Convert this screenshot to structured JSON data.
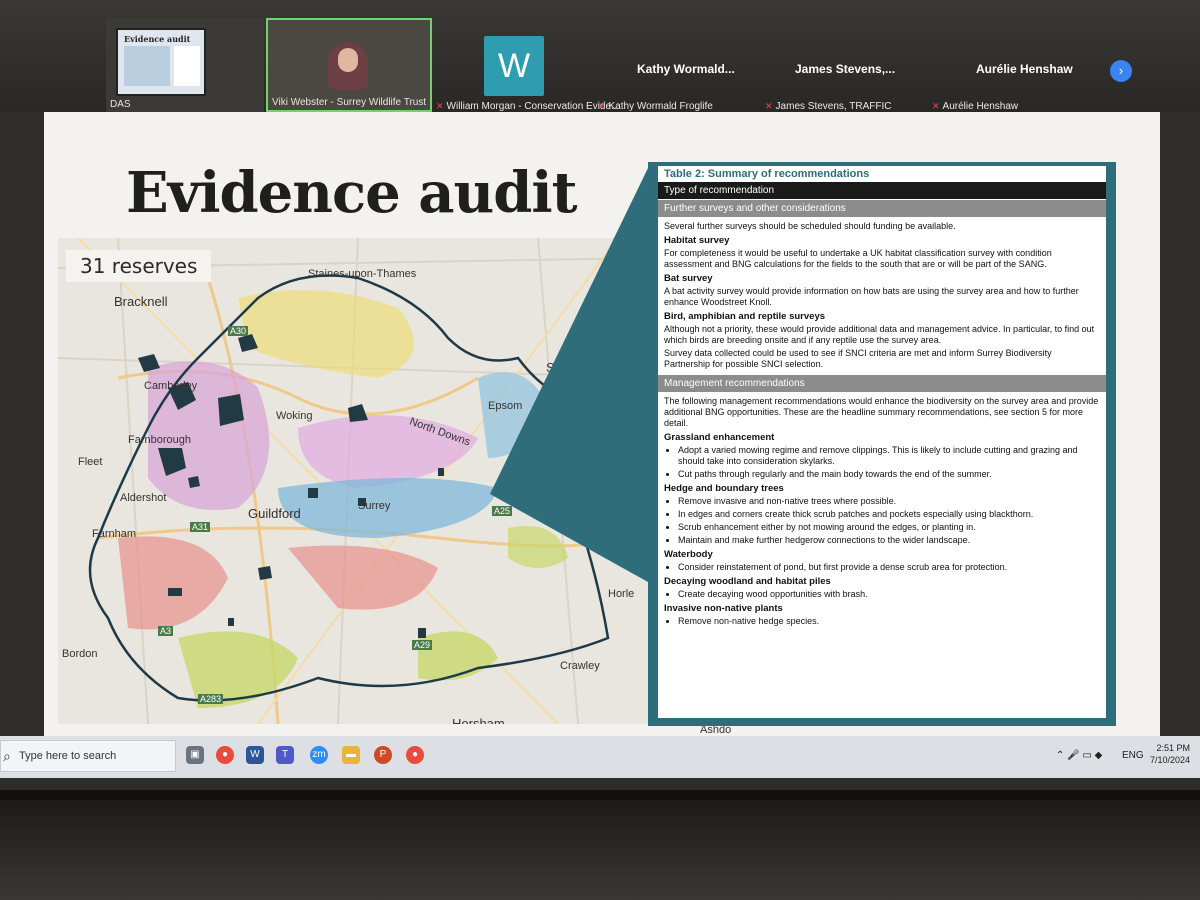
{
  "participants": {
    "tile1_caption": "DAS",
    "tile1_thumb_title": "Evidence audit",
    "tile2_caption": "Viki Webster - Surrey Wildlife Trust",
    "avatar_letter": "W",
    "cap_william": "William Morgan - Conservation Evide...",
    "name_kathy": "Kathy Wormald...",
    "cap_kathy": "Kathy Wormald Froglife",
    "name_james": "James Stevens,...",
    "cap_james": "James Stevens, TRAFFIC",
    "name_aurelie": "Aurélie Henshaw",
    "cap_aurelie": "Aurélie Henshaw",
    "next_glyph": "›"
  },
  "slide": {
    "title": "Evidence audit",
    "badge": "31 reserves",
    "places": {
      "staines": "Staines-upon-Thames",
      "bracknell": "Bracknell",
      "sutton": "Sutton",
      "camberley": "Camberley",
      "woking": "Woking",
      "epsom": "Epsom",
      "farnborough": "Farnborough",
      "north_downs": "North Downs",
      "fleet": "Fleet",
      "aldershot": "Aldershot",
      "guildford": "Guildford",
      "surrey": "Surrey",
      "farnham": "Farnham",
      "bordon": "Bordon",
      "horley": "Horle",
      "crawley": "Crawley",
      "horsham": "Horsham",
      "ashdown": "Ashdo"
    },
    "roads": {
      "a30": "A30",
      "a31": "A31",
      "a3": "A3",
      "a25": "A25",
      "a29": "A29",
      "a283": "A283"
    }
  },
  "table": {
    "caption": "Table 2: Summary of recommendations",
    "header": "Type of recommendation",
    "section1": "Further surveys and other considerations",
    "s1_intro": "Several further surveys should be scheduled should funding be available.",
    "h_habitat": "Habitat survey",
    "p_habitat": "For completeness it would be useful to undertake a UK habitat classification survey with condition assessment and BNG calculations for the fields to the south that are or will be part of the SANG.",
    "h_bat": "Bat survey",
    "p_bat": "A bat activity survey would provide information on how bats are using the survey area and how to further enhance Woodstreet Knoll.",
    "h_bird": "Bird, amphibian and reptile surveys",
    "p_bird": "Although not a priority, these would provide additional data and management advice.  In particular, to find out which birds are breeding onsite and if any reptile use the survey area.",
    "p_snci": "Survey data collected could be used to see if SNCI criteria are met and inform Surrey Biodiversity Partnership for possible SNCI selection.",
    "section2": "Management recommendations",
    "s2_intro": "The following management recommendations would enhance the biodiversity on the survey area and provide additional BNG opportunities. These are the headline summary recommendations, see section 5 for more detail.",
    "h_grass": "Grassland enhancement",
    "li_grass_1": "Adopt a varied mowing regime and remove clippings.  This is likely to include cutting and grazing and should take into consideration skylarks.",
    "li_grass_2": "Cut paths through regularly and the main body towards the end of the summer.",
    "h_hedge": "Hedge and boundary trees",
    "li_hedge_1": "Remove invasive and non-native trees where possible.",
    "li_hedge_2": "In edges and corners create thick scrub patches and pockets especially using blackthorn.",
    "li_hedge_3": "Scrub enhancement either by not mowing around the edges, or planting in.",
    "li_hedge_4": "Maintain and make further hedgerow connections to the wider landscape.",
    "h_water": "Waterbody",
    "li_water_1": "Consider reinstatement of pond, but first provide a dense scrub area for protection.",
    "h_decay": "Decaying woodland and habitat piles",
    "li_decay_1": "Create decaying wood opportunities with brash.",
    "h_invasive": "Invasive non-native plants",
    "li_invasive_1": "Remove non-native hedge species."
  },
  "taskbar": {
    "search_placeholder": "Type here to search",
    "zoom_label": "zm",
    "word_label": "W",
    "ppt_label": "P",
    "lang": "ENG",
    "time": "2:51 PM",
    "date": "7/10/2024"
  },
  "colors": {
    "accent_teal": "#2f6d7a",
    "map_purple": "#d9a3d9",
    "map_blue": "#7fb8d9",
    "map_red": "#e8908c",
    "map_green": "#c7d86a",
    "map_yellow": "#eedc6a",
    "reserve_dark": "#223a44"
  }
}
